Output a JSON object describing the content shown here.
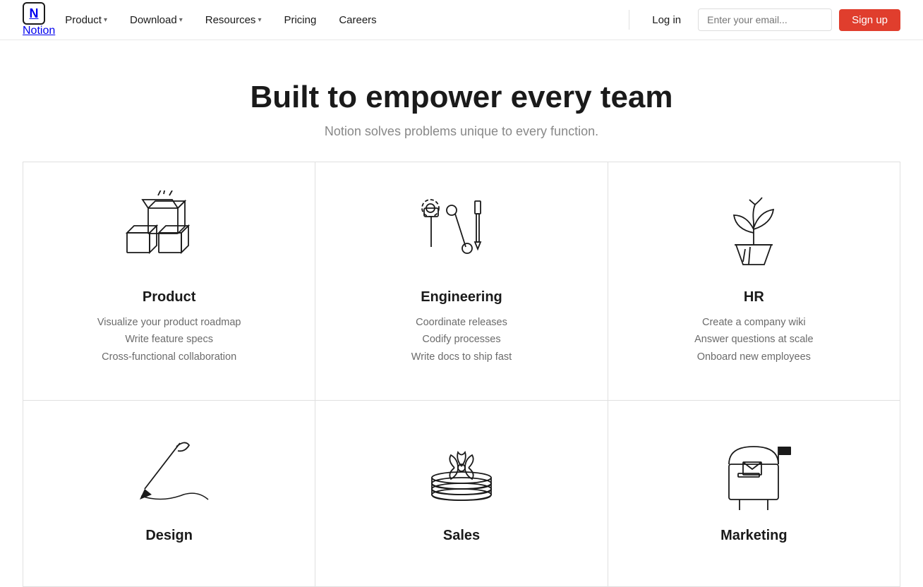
{
  "brand": {
    "logo_letter": "N",
    "name": "Notion"
  },
  "nav": {
    "items": [
      {
        "label": "Product",
        "has_dropdown": true
      },
      {
        "label": "Download",
        "has_dropdown": true
      },
      {
        "label": "Resources",
        "has_dropdown": true
      },
      {
        "label": "Pricing",
        "has_dropdown": false
      },
      {
        "label": "Careers",
        "has_dropdown": false
      }
    ],
    "login_label": "Log in",
    "email_placeholder": "Enter your email...",
    "signup_label": "Sign up"
  },
  "hero": {
    "title": "Built to empower every team",
    "subtitle": "Notion solves problems unique to every function."
  },
  "teams": [
    {
      "name": "Product",
      "icon_type": "boxes",
      "descriptions": [
        "Visualize your product roadmap",
        "Write feature specs",
        "Cross-functional collaboration"
      ]
    },
    {
      "name": "Engineering",
      "icon_type": "tools",
      "descriptions": [
        "Coordinate releases",
        "Codify processes",
        "Write docs to ship fast"
      ]
    },
    {
      "name": "HR",
      "icon_type": "plant",
      "descriptions": [
        "Create a company wiki",
        "Answer questions at scale",
        "Onboard new employees"
      ]
    },
    {
      "name": "Design",
      "icon_type": "pen",
      "descriptions": [
        "",
        "",
        ""
      ]
    },
    {
      "name": "Sales",
      "icon_type": "stack",
      "descriptions": [
        "",
        "",
        ""
      ]
    },
    {
      "name": "Marketing",
      "icon_type": "mailbox",
      "descriptions": [
        "",
        "",
        ""
      ]
    }
  ]
}
